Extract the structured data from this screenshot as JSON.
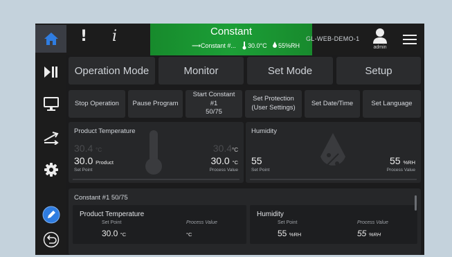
{
  "topbar": {
    "alert_glyph": "!",
    "info_glyph": "i",
    "status_title": "Constant",
    "status_program": "⟶Constant #...",
    "status_temperature": "30.0°C",
    "status_humidity": "55%RH",
    "device_id": "GL-WEB-DEMO-1",
    "user_label": "admin"
  },
  "tabs": [
    "Operation Mode",
    "Monitor",
    "Set Mode",
    "Setup"
  ],
  "actions": {
    "stop": "Stop Operation",
    "pause": "Pause Program",
    "start_line1": "Start Constant",
    "start_line2": "#1",
    "start_line3": "50/75",
    "protection_line1": "Set Protection",
    "protection_line2": "(User Settings)",
    "datetime": "Set Date/Time",
    "language": "Set Language"
  },
  "product_temp_panel": {
    "title": "Product Temperature",
    "ghost_left": "30.4",
    "ghost_left_unit": "°C",
    "ghost_right": "30.4",
    "ghost_right_unit": "°C",
    "set_value": "30.0",
    "set_unit": "Product",
    "set_label": "Set Point",
    "process_value": "30.0",
    "process_unit": "°C",
    "process_label": "Process Value"
  },
  "humidity_panel": {
    "title": "Humidity",
    "set_value": "55",
    "set_label": "Set Point",
    "process_value": "55",
    "process_unit": "%RH",
    "process_label": "Process Value"
  },
  "program": {
    "title": "Constant #1 50/75",
    "temp": {
      "title": "Product Temperature",
      "set_label": "Set Point",
      "process_label": "Process Value",
      "set_value": "30.0",
      "set_unit": "°C",
      "process_unit": "°C"
    },
    "humidity": {
      "title": "Humidity",
      "set_label": "Set Point",
      "process_label": "Process Value",
      "set_value": "55",
      "set_unit": "%RH",
      "process_value": "55",
      "process_unit": "%RH"
    }
  },
  "colors": {
    "status_green": "#1c9f37",
    "active_blue": "#2f7de1",
    "panel": "#262729",
    "frame": "#1b1b1c"
  },
  "icons": [
    "home-icon",
    "play-pause-icon",
    "monitor-icon",
    "transfer-icon",
    "gear-icon",
    "edit-icon",
    "back-icon",
    "user-icon",
    "menu-icon",
    "thermometer-icon",
    "droplet-icon"
  ]
}
